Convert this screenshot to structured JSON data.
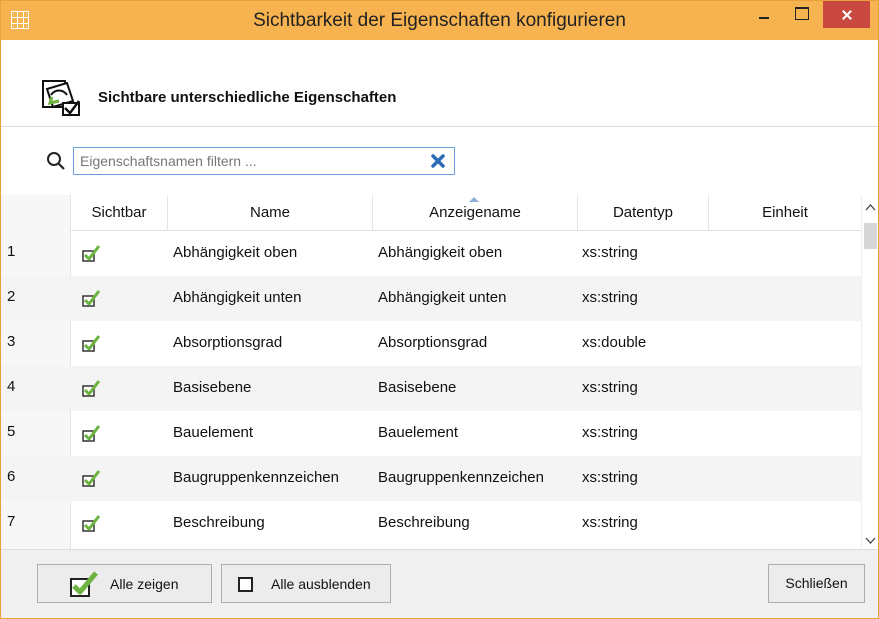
{
  "window": {
    "title": "Sichtbarkeit der Eigenschaften konfigurieren"
  },
  "header": {
    "title": "Sichtbare unterschiedliche Eigenschaften"
  },
  "search": {
    "placeholder": "Eigenschaftsnamen filtern ...",
    "value": ""
  },
  "table": {
    "columns": {
      "visible": "Sichtbar",
      "name": "Name",
      "display_name": "Anzeigename",
      "data_type": "Datentyp",
      "unit": "Einheit"
    },
    "sorted_column": "Anzeigename",
    "rows": [
      {
        "num": "1",
        "visible": true,
        "name": "Abhängigkeit oben",
        "display_name": "Abhängigkeit oben",
        "data_type": "xs:string",
        "unit": ""
      },
      {
        "num": "2",
        "visible": true,
        "name": "Abhängigkeit unten",
        "display_name": "Abhängigkeit unten",
        "data_type": "xs:string",
        "unit": ""
      },
      {
        "num": "3",
        "visible": true,
        "name": "Absorptionsgrad",
        "display_name": "Absorptionsgrad",
        "data_type": "xs:double",
        "unit": ""
      },
      {
        "num": "4",
        "visible": true,
        "name": "Basisebene",
        "display_name": "Basisebene",
        "data_type": "xs:string",
        "unit": ""
      },
      {
        "num": "5",
        "visible": true,
        "name": "Bauelement",
        "display_name": "Bauelement",
        "data_type": "xs:string",
        "unit": ""
      },
      {
        "num": "6",
        "visible": true,
        "name": "Baugruppenkennzeichen",
        "display_name": "Baugruppenkennzeichen",
        "data_type": "xs:string",
        "unit": ""
      },
      {
        "num": "7",
        "visible": true,
        "name": "Beschreibung",
        "display_name": "Beschreibung",
        "data_type": "xs:string",
        "unit": ""
      }
    ]
  },
  "footer": {
    "show_all_label": "Alle zeigen",
    "hide_all_label": "Alle ausblenden",
    "close_label": "Schließen"
  },
  "colors": {
    "titlebar": "#f6b350",
    "close_button": "#c9483f",
    "check_green": "#6db33f",
    "input_border": "#6aa0d8"
  },
  "icons": {
    "app": "grid-icon",
    "header": "properties-visibility-icon",
    "search": "search-icon",
    "clear": "clear-x-icon",
    "row_visible": "check-icon"
  }
}
